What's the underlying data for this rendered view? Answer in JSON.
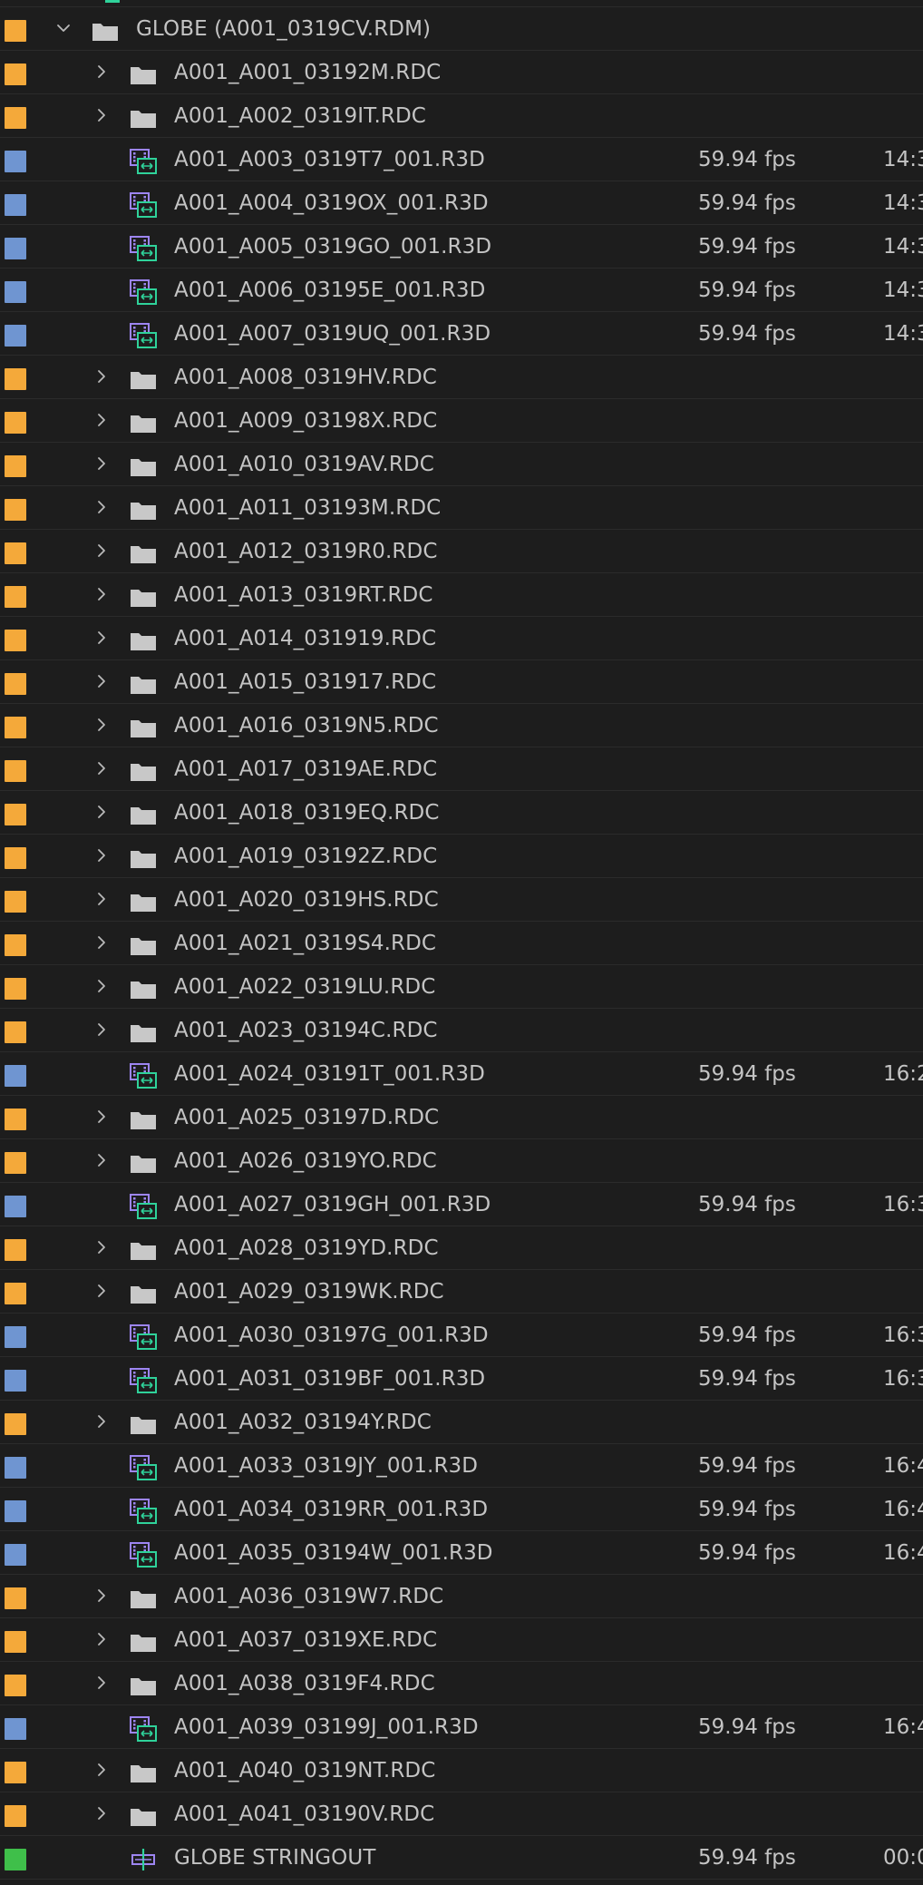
{
  "colors": {
    "bin_label": "#f4a93a",
    "clip_label": "#6f95d1",
    "sequence_label": "#3fbf4a",
    "clip_icon": "#9d85f2",
    "clip_icon_accent": "#2fd29a",
    "folder_icon": "#c8c8c8",
    "text": "#c4c4c4",
    "background": "#1d1d1d"
  },
  "rows": [
    {
      "kind": "bin",
      "depth": 0,
      "expanded": true,
      "name": "GLOBE (A001_0319CV.RDM)",
      "icon": "folder-icon",
      "label_color": "bin_label",
      "fps": "",
      "tc": ""
    },
    {
      "kind": "bin",
      "depth": 1,
      "expanded": false,
      "name": "A001_A001_03192M.RDC",
      "icon": "folder-icon",
      "label_color": "bin_label",
      "fps": "",
      "tc": ""
    },
    {
      "kind": "bin",
      "depth": 1,
      "expanded": false,
      "name": "A001_A002_0319IT.RDC",
      "icon": "folder-icon",
      "label_color": "bin_label",
      "fps": "",
      "tc": ""
    },
    {
      "kind": "clip",
      "depth": 1,
      "name": "A001_A003_0319T7_001.R3D",
      "icon": "clip-icon",
      "label_color": "clip_label",
      "fps": "59.94 fps",
      "tc": "14:3"
    },
    {
      "kind": "clip",
      "depth": 1,
      "name": "A001_A004_0319OX_001.R3D",
      "icon": "clip-icon",
      "label_color": "clip_label",
      "fps": "59.94 fps",
      "tc": "14:3"
    },
    {
      "kind": "clip",
      "depth": 1,
      "name": "A001_A005_0319GO_001.R3D",
      "icon": "clip-icon",
      "label_color": "clip_label",
      "fps": "59.94 fps",
      "tc": "14:3"
    },
    {
      "kind": "clip",
      "depth": 1,
      "name": "A001_A006_03195E_001.R3D",
      "icon": "clip-icon",
      "label_color": "clip_label",
      "fps": "59.94 fps",
      "tc": "14:3"
    },
    {
      "kind": "clip",
      "depth": 1,
      "name": "A001_A007_0319UQ_001.R3D",
      "icon": "clip-icon",
      "label_color": "clip_label",
      "fps": "59.94 fps",
      "tc": "14:3"
    },
    {
      "kind": "bin",
      "depth": 1,
      "expanded": false,
      "name": "A001_A008_0319HV.RDC",
      "icon": "folder-icon",
      "label_color": "bin_label",
      "fps": "",
      "tc": ""
    },
    {
      "kind": "bin",
      "depth": 1,
      "expanded": false,
      "name": "A001_A009_03198X.RDC",
      "icon": "folder-icon",
      "label_color": "bin_label",
      "fps": "",
      "tc": ""
    },
    {
      "kind": "bin",
      "depth": 1,
      "expanded": false,
      "name": "A001_A010_0319AV.RDC",
      "icon": "folder-icon",
      "label_color": "bin_label",
      "fps": "",
      "tc": ""
    },
    {
      "kind": "bin",
      "depth": 1,
      "expanded": false,
      "name": "A001_A011_03193M.RDC",
      "icon": "folder-icon",
      "label_color": "bin_label",
      "fps": "",
      "tc": ""
    },
    {
      "kind": "bin",
      "depth": 1,
      "expanded": false,
      "name": "A001_A012_0319R0.RDC",
      "icon": "folder-icon",
      "label_color": "bin_label",
      "fps": "",
      "tc": ""
    },
    {
      "kind": "bin",
      "depth": 1,
      "expanded": false,
      "name": "A001_A013_0319RT.RDC",
      "icon": "folder-icon",
      "label_color": "bin_label",
      "fps": "",
      "tc": ""
    },
    {
      "kind": "bin",
      "depth": 1,
      "expanded": false,
      "name": "A001_A014_031919.RDC",
      "icon": "folder-icon",
      "label_color": "bin_label",
      "fps": "",
      "tc": ""
    },
    {
      "kind": "bin",
      "depth": 1,
      "expanded": false,
      "name": "A001_A015_031917.RDC",
      "icon": "folder-icon",
      "label_color": "bin_label",
      "fps": "",
      "tc": ""
    },
    {
      "kind": "bin",
      "depth": 1,
      "expanded": false,
      "name": "A001_A016_0319N5.RDC",
      "icon": "folder-icon",
      "label_color": "bin_label",
      "fps": "",
      "tc": ""
    },
    {
      "kind": "bin",
      "depth": 1,
      "expanded": false,
      "name": "A001_A017_0319AE.RDC",
      "icon": "folder-icon",
      "label_color": "bin_label",
      "fps": "",
      "tc": ""
    },
    {
      "kind": "bin",
      "depth": 1,
      "expanded": false,
      "name": "A001_A018_0319EQ.RDC",
      "icon": "folder-icon",
      "label_color": "bin_label",
      "fps": "",
      "tc": ""
    },
    {
      "kind": "bin",
      "depth": 1,
      "expanded": false,
      "name": "A001_A019_03192Z.RDC",
      "icon": "folder-icon",
      "label_color": "bin_label",
      "fps": "",
      "tc": ""
    },
    {
      "kind": "bin",
      "depth": 1,
      "expanded": false,
      "name": "A001_A020_0319HS.RDC",
      "icon": "folder-icon",
      "label_color": "bin_label",
      "fps": "",
      "tc": ""
    },
    {
      "kind": "bin",
      "depth": 1,
      "expanded": false,
      "name": "A001_A021_0319S4.RDC",
      "icon": "folder-icon",
      "label_color": "bin_label",
      "fps": "",
      "tc": ""
    },
    {
      "kind": "bin",
      "depth": 1,
      "expanded": false,
      "name": "A001_A022_0319LU.RDC",
      "icon": "folder-icon",
      "label_color": "bin_label",
      "fps": "",
      "tc": ""
    },
    {
      "kind": "bin",
      "depth": 1,
      "expanded": false,
      "name": "A001_A023_03194C.RDC",
      "icon": "folder-icon",
      "label_color": "bin_label",
      "fps": "",
      "tc": ""
    },
    {
      "kind": "clip",
      "depth": 1,
      "name": "A001_A024_03191T_001.R3D",
      "icon": "clip-icon",
      "label_color": "clip_label",
      "fps": "59.94 fps",
      "tc": "16:2"
    },
    {
      "kind": "bin",
      "depth": 1,
      "expanded": false,
      "name": "A001_A025_03197D.RDC",
      "icon": "folder-icon",
      "label_color": "bin_label",
      "fps": "",
      "tc": ""
    },
    {
      "kind": "bin",
      "depth": 1,
      "expanded": false,
      "name": "A001_A026_0319YO.RDC",
      "icon": "folder-icon",
      "label_color": "bin_label",
      "fps": "",
      "tc": ""
    },
    {
      "kind": "clip",
      "depth": 1,
      "name": "A001_A027_0319GH_001.R3D",
      "icon": "clip-icon",
      "label_color": "clip_label",
      "fps": "59.94 fps",
      "tc": "16:3"
    },
    {
      "kind": "bin",
      "depth": 1,
      "expanded": false,
      "name": "A001_A028_0319YD.RDC",
      "icon": "folder-icon",
      "label_color": "bin_label",
      "fps": "",
      "tc": ""
    },
    {
      "kind": "bin",
      "depth": 1,
      "expanded": false,
      "name": "A001_A029_0319WK.RDC",
      "icon": "folder-icon",
      "label_color": "bin_label",
      "fps": "",
      "tc": ""
    },
    {
      "kind": "clip",
      "depth": 1,
      "name": "A001_A030_03197G_001.R3D",
      "icon": "clip-icon",
      "label_color": "clip_label",
      "fps": "59.94 fps",
      "tc": "16:3"
    },
    {
      "kind": "clip",
      "depth": 1,
      "name": "A001_A031_0319BF_001.R3D",
      "icon": "clip-icon",
      "label_color": "clip_label",
      "fps": "59.94 fps",
      "tc": "16:3"
    },
    {
      "kind": "bin",
      "depth": 1,
      "expanded": false,
      "name": "A001_A032_03194Y.RDC",
      "icon": "folder-icon",
      "label_color": "bin_label",
      "fps": "",
      "tc": ""
    },
    {
      "kind": "clip",
      "depth": 1,
      "name": "A001_A033_0319JY_001.R3D",
      "icon": "clip-icon",
      "label_color": "clip_label",
      "fps": "59.94 fps",
      "tc": "16:4"
    },
    {
      "kind": "clip",
      "depth": 1,
      "name": "A001_A034_0319RR_001.R3D",
      "icon": "clip-icon",
      "label_color": "clip_label",
      "fps": "59.94 fps",
      "tc": "16:4"
    },
    {
      "kind": "clip",
      "depth": 1,
      "name": "A001_A035_03194W_001.R3D",
      "icon": "clip-icon",
      "label_color": "clip_label",
      "fps": "59.94 fps",
      "tc": "16:4"
    },
    {
      "kind": "bin",
      "depth": 1,
      "expanded": false,
      "name": "A001_A036_0319W7.RDC",
      "icon": "folder-icon",
      "label_color": "bin_label",
      "fps": "",
      "tc": ""
    },
    {
      "kind": "bin",
      "depth": 1,
      "expanded": false,
      "name": "A001_A037_0319XE.RDC",
      "icon": "folder-icon",
      "label_color": "bin_label",
      "fps": "",
      "tc": ""
    },
    {
      "kind": "bin",
      "depth": 1,
      "expanded": false,
      "name": "A001_A038_0319F4.RDC",
      "icon": "folder-icon",
      "label_color": "bin_label",
      "fps": "",
      "tc": ""
    },
    {
      "kind": "clip",
      "depth": 1,
      "name": "A001_A039_03199J_001.R3D",
      "icon": "clip-icon",
      "label_color": "clip_label",
      "fps": "59.94 fps",
      "tc": "16:4"
    },
    {
      "kind": "bin",
      "depth": 1,
      "expanded": false,
      "name": "A001_A040_0319NT.RDC",
      "icon": "folder-icon",
      "label_color": "bin_label",
      "fps": "",
      "tc": ""
    },
    {
      "kind": "bin",
      "depth": 1,
      "expanded": false,
      "name": "A001_A041_03190V.RDC",
      "icon": "folder-icon",
      "label_color": "bin_label",
      "fps": "",
      "tc": ""
    },
    {
      "kind": "sequence",
      "depth": 1,
      "name": "GLOBE STRINGOUT",
      "icon": "sequence-icon",
      "label_color": "sequence_label",
      "fps": "59.94 fps",
      "tc": "00:0"
    }
  ]
}
